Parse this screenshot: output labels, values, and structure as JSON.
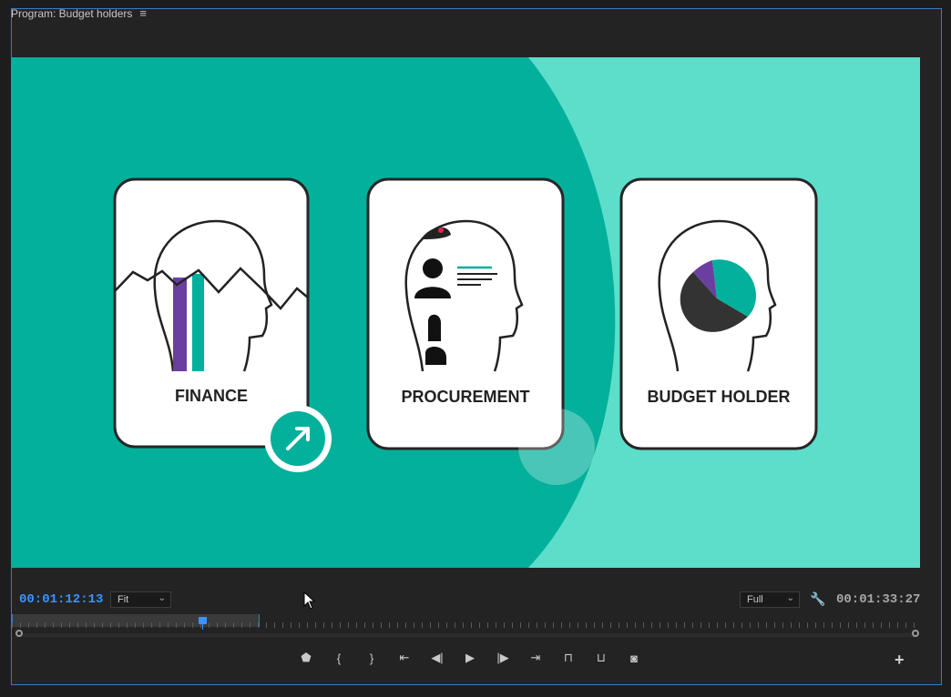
{
  "panel": {
    "title": "Program: Budget holders",
    "menu_icon": "hamburger-menu-icon"
  },
  "viewer": {
    "colors": {
      "background_dark": "#03b09b",
      "background_light": "#5cdecb",
      "card_fill": "#ffffff",
      "card_border": "#262626",
      "accent_purple": "#6b3fa0",
      "accent_teal": "#03b09b"
    },
    "cards": [
      {
        "label": "FINANCE"
      },
      {
        "label": "PROCUREMENT"
      },
      {
        "label": "BUDGET HOLDER"
      }
    ]
  },
  "controls": {
    "current_timecode": "00:01:12:13",
    "zoom_select": "Fit",
    "resolution_select": "Full",
    "duration_timecode": "00:01:33:27",
    "settings_icon": "wrench-icon",
    "playhead_position": 0.21
  },
  "transport": [
    {
      "name": "add-marker-button",
      "icon": "marker-icon",
      "glyph": "⬟"
    },
    {
      "name": "mark-in-button",
      "icon": "mark-in-icon",
      "glyph": "{"
    },
    {
      "name": "mark-out-button",
      "icon": "mark-out-icon",
      "glyph": "}"
    },
    {
      "name": "go-to-in-button",
      "icon": "go-to-in-icon",
      "glyph": "⇤"
    },
    {
      "name": "step-back-button",
      "icon": "step-back-icon",
      "glyph": "◀|"
    },
    {
      "name": "play-button",
      "icon": "play-icon",
      "glyph": "▶"
    },
    {
      "name": "step-forward-button",
      "icon": "step-forward-icon",
      "glyph": "|▶"
    },
    {
      "name": "go-to-out-button",
      "icon": "go-to-out-icon",
      "glyph": "⇥"
    },
    {
      "name": "lift-button",
      "icon": "lift-icon",
      "glyph": "⊓"
    },
    {
      "name": "extract-button",
      "icon": "extract-icon",
      "glyph": "⊔"
    },
    {
      "name": "export-frame-button",
      "icon": "camera-icon",
      "glyph": "◙"
    }
  ],
  "button_editor": {
    "icon": "plus-icon",
    "glyph": "+"
  }
}
